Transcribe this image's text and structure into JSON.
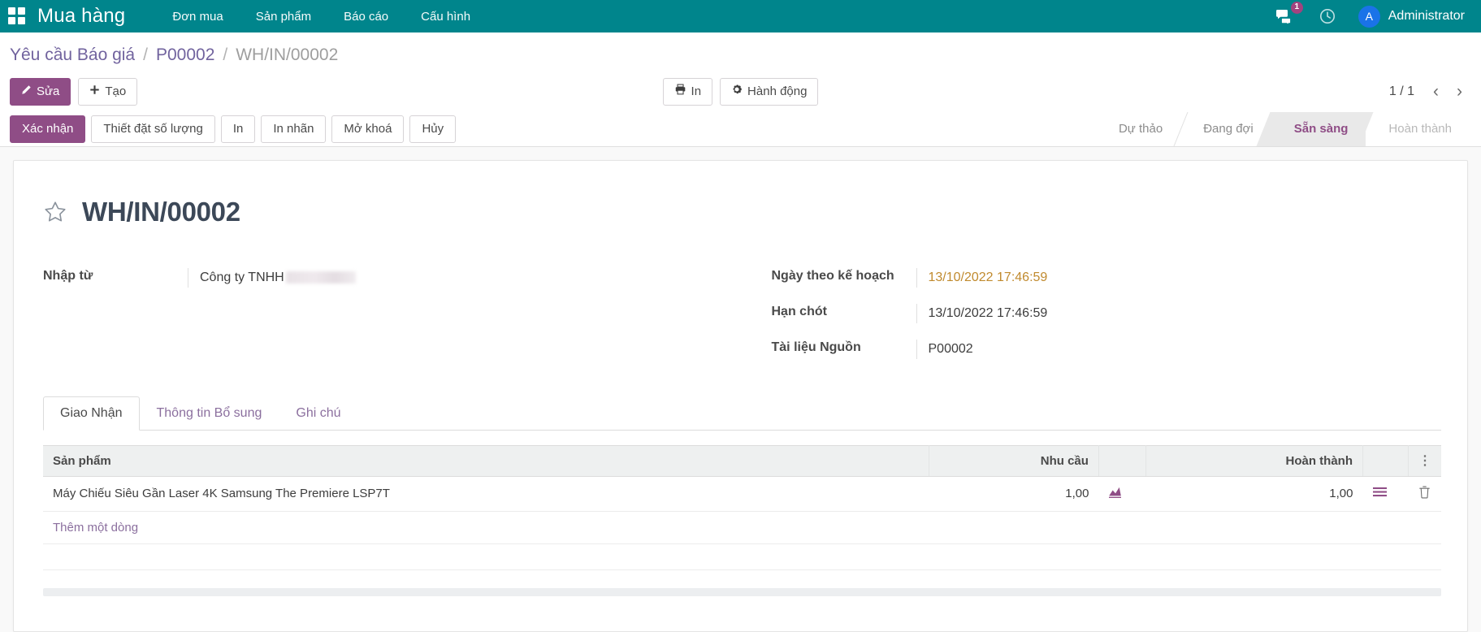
{
  "navbar": {
    "apps_icon": "apps-grid-icon",
    "brand": "Mua hàng",
    "menu": [
      {
        "label": "Đơn mua"
      },
      {
        "label": "Sản phẩm"
      },
      {
        "label": "Báo cáo"
      },
      {
        "label": "Cấu hình"
      }
    ],
    "messages_icon": "messages-icon",
    "messages_count": "1",
    "activity_icon": "clock-icon",
    "avatar_initial": "A",
    "username": "Administrator",
    "bg_color": "#00858c",
    "badge_color": "#a2437f",
    "avatar_color": "#1a73e8"
  },
  "breadcrumb": {
    "items": [
      {
        "label": "Yêu cầu Báo giá",
        "current": false
      },
      {
        "label": "P00002",
        "current": false
      },
      {
        "label": "WH/IN/00002",
        "current": true
      }
    ],
    "separator": "/"
  },
  "control_panel": {
    "edit_label": "Sửa",
    "edit_icon": "pencil-icon",
    "create_label": "Tạo",
    "create_icon": "plus-icon",
    "print_label": "In",
    "print_icon": "printer-icon",
    "action_label": "Hành động",
    "action_icon": "gear-icon",
    "pager": "1 / 1",
    "prev_icon": "chevron-left-icon",
    "next_icon": "chevron-right-icon",
    "primary_color": "#8f4d86"
  },
  "statusbar": {
    "buttons": [
      {
        "label": "Xác nhận",
        "primary": true
      },
      {
        "label": "Thiết đặt số lượng",
        "primary": false
      },
      {
        "label": "In",
        "primary": false
      },
      {
        "label": "In nhãn",
        "primary": false
      },
      {
        "label": "Mở khoá",
        "primary": false
      },
      {
        "label": "Hủy",
        "primary": false
      }
    ],
    "stages": [
      {
        "label": "Dự thảo",
        "state": "done"
      },
      {
        "label": "Đang đợi",
        "state": "done"
      },
      {
        "label": "Sẵn sàng",
        "state": "current"
      },
      {
        "label": "Hoàn thành",
        "state": "pending"
      }
    ],
    "active_color": "#8f4d86"
  },
  "record": {
    "star_icon": "star-outline-icon",
    "title": "WH/IN/00002",
    "fields_left": [
      {
        "label": "Nhập từ",
        "value": "Công ty TNHH",
        "redacted": true
      }
    ],
    "fields_right": [
      {
        "label": "Ngày theo kế hoạch",
        "value": "13/10/2022 17:46:59",
        "highlight": true
      },
      {
        "label": "Hạn chót",
        "value": "13/10/2022 17:46:59",
        "highlight": false
      },
      {
        "label": "Tài liệu Nguồn",
        "value": "P00002",
        "highlight": false
      }
    ],
    "highlight_color": "#c08a2e"
  },
  "notebook": {
    "tabs": [
      {
        "label": "Giao Nhận",
        "active": true
      },
      {
        "label": "Thông tin Bổ sung",
        "active": false
      },
      {
        "label": "Ghi chú",
        "active": false
      }
    ]
  },
  "lines_table": {
    "columns": [
      {
        "label": "Sản phẩm",
        "align": "left"
      },
      {
        "label": "Nhu cầu",
        "align": "right"
      },
      {
        "label": "",
        "align": "left"
      },
      {
        "label": "Hoàn thành",
        "align": "right"
      },
      {
        "label": "",
        "align": "left"
      },
      {
        "label": "",
        "align": "left"
      }
    ],
    "options_icon": "options-menu-icon",
    "rows": [
      {
        "product": "Máy Chiếu Siêu Gần Laser 4K Samsung The Premiere LSP7T",
        "demand": "1,00",
        "demand_icon": "chart-icon",
        "done": "1,00",
        "done_icon": "list-icon",
        "delete_icon": "trash-icon"
      }
    ],
    "add_line_label": "Thêm một dòng",
    "link_color": "#8b6f9e",
    "chart_icon_color": "#8f4d86",
    "list_icon_color": "#8f4d86"
  }
}
